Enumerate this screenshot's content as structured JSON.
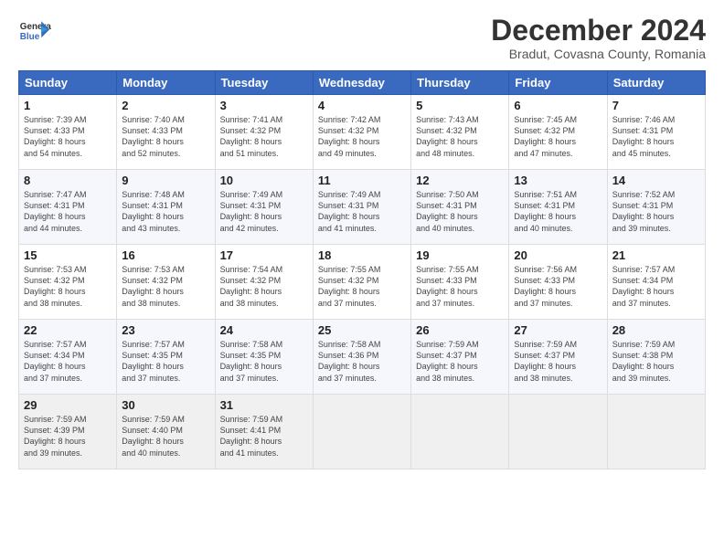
{
  "logo": {
    "line1": "General",
    "line2": "Blue"
  },
  "title": "December 2024",
  "subtitle": "Bradut, Covasna County, Romania",
  "weekdays": [
    "Sunday",
    "Monday",
    "Tuesday",
    "Wednesday",
    "Thursday",
    "Friday",
    "Saturday"
  ],
  "weeks": [
    [
      {
        "day": "1",
        "lines": [
          "Sunrise: 7:39 AM",
          "Sunset: 4:33 PM",
          "Daylight: 8 hours",
          "and 54 minutes."
        ]
      },
      {
        "day": "2",
        "lines": [
          "Sunrise: 7:40 AM",
          "Sunset: 4:33 PM",
          "Daylight: 8 hours",
          "and 52 minutes."
        ]
      },
      {
        "day": "3",
        "lines": [
          "Sunrise: 7:41 AM",
          "Sunset: 4:32 PM",
          "Daylight: 8 hours",
          "and 51 minutes."
        ]
      },
      {
        "day": "4",
        "lines": [
          "Sunrise: 7:42 AM",
          "Sunset: 4:32 PM",
          "Daylight: 8 hours",
          "and 49 minutes."
        ]
      },
      {
        "day": "5",
        "lines": [
          "Sunrise: 7:43 AM",
          "Sunset: 4:32 PM",
          "Daylight: 8 hours",
          "and 48 minutes."
        ]
      },
      {
        "day": "6",
        "lines": [
          "Sunrise: 7:45 AM",
          "Sunset: 4:32 PM",
          "Daylight: 8 hours",
          "and 47 minutes."
        ]
      },
      {
        "day": "7",
        "lines": [
          "Sunrise: 7:46 AM",
          "Sunset: 4:31 PM",
          "Daylight: 8 hours",
          "and 45 minutes."
        ]
      }
    ],
    [
      {
        "day": "8",
        "lines": [
          "Sunrise: 7:47 AM",
          "Sunset: 4:31 PM",
          "Daylight: 8 hours",
          "and 44 minutes."
        ]
      },
      {
        "day": "9",
        "lines": [
          "Sunrise: 7:48 AM",
          "Sunset: 4:31 PM",
          "Daylight: 8 hours",
          "and 43 minutes."
        ]
      },
      {
        "day": "10",
        "lines": [
          "Sunrise: 7:49 AM",
          "Sunset: 4:31 PM",
          "Daylight: 8 hours",
          "and 42 minutes."
        ]
      },
      {
        "day": "11",
        "lines": [
          "Sunrise: 7:49 AM",
          "Sunset: 4:31 PM",
          "Daylight: 8 hours",
          "and 41 minutes."
        ]
      },
      {
        "day": "12",
        "lines": [
          "Sunrise: 7:50 AM",
          "Sunset: 4:31 PM",
          "Daylight: 8 hours",
          "and 40 minutes."
        ]
      },
      {
        "day": "13",
        "lines": [
          "Sunrise: 7:51 AM",
          "Sunset: 4:31 PM",
          "Daylight: 8 hours",
          "and 40 minutes."
        ]
      },
      {
        "day": "14",
        "lines": [
          "Sunrise: 7:52 AM",
          "Sunset: 4:31 PM",
          "Daylight: 8 hours",
          "and 39 minutes."
        ]
      }
    ],
    [
      {
        "day": "15",
        "lines": [
          "Sunrise: 7:53 AM",
          "Sunset: 4:32 PM",
          "Daylight: 8 hours",
          "and 38 minutes."
        ]
      },
      {
        "day": "16",
        "lines": [
          "Sunrise: 7:53 AM",
          "Sunset: 4:32 PM",
          "Daylight: 8 hours",
          "and 38 minutes."
        ]
      },
      {
        "day": "17",
        "lines": [
          "Sunrise: 7:54 AM",
          "Sunset: 4:32 PM",
          "Daylight: 8 hours",
          "and 38 minutes."
        ]
      },
      {
        "day": "18",
        "lines": [
          "Sunrise: 7:55 AM",
          "Sunset: 4:32 PM",
          "Daylight: 8 hours",
          "and 37 minutes."
        ]
      },
      {
        "day": "19",
        "lines": [
          "Sunrise: 7:55 AM",
          "Sunset: 4:33 PM",
          "Daylight: 8 hours",
          "and 37 minutes."
        ]
      },
      {
        "day": "20",
        "lines": [
          "Sunrise: 7:56 AM",
          "Sunset: 4:33 PM",
          "Daylight: 8 hours",
          "and 37 minutes."
        ]
      },
      {
        "day": "21",
        "lines": [
          "Sunrise: 7:57 AM",
          "Sunset: 4:34 PM",
          "Daylight: 8 hours",
          "and 37 minutes."
        ]
      }
    ],
    [
      {
        "day": "22",
        "lines": [
          "Sunrise: 7:57 AM",
          "Sunset: 4:34 PM",
          "Daylight: 8 hours",
          "and 37 minutes."
        ]
      },
      {
        "day": "23",
        "lines": [
          "Sunrise: 7:57 AM",
          "Sunset: 4:35 PM",
          "Daylight: 8 hours",
          "and 37 minutes."
        ]
      },
      {
        "day": "24",
        "lines": [
          "Sunrise: 7:58 AM",
          "Sunset: 4:35 PM",
          "Daylight: 8 hours",
          "and 37 minutes."
        ]
      },
      {
        "day": "25",
        "lines": [
          "Sunrise: 7:58 AM",
          "Sunset: 4:36 PM",
          "Daylight: 8 hours",
          "and 37 minutes."
        ]
      },
      {
        "day": "26",
        "lines": [
          "Sunrise: 7:59 AM",
          "Sunset: 4:37 PM",
          "Daylight: 8 hours",
          "and 38 minutes."
        ]
      },
      {
        "day": "27",
        "lines": [
          "Sunrise: 7:59 AM",
          "Sunset: 4:37 PM",
          "Daylight: 8 hours",
          "and 38 minutes."
        ]
      },
      {
        "day": "28",
        "lines": [
          "Sunrise: 7:59 AM",
          "Sunset: 4:38 PM",
          "Daylight: 8 hours",
          "and 39 minutes."
        ]
      }
    ],
    [
      {
        "day": "29",
        "lines": [
          "Sunrise: 7:59 AM",
          "Sunset: 4:39 PM",
          "Daylight: 8 hours",
          "and 39 minutes."
        ]
      },
      {
        "day": "30",
        "lines": [
          "Sunrise: 7:59 AM",
          "Sunset: 4:40 PM",
          "Daylight: 8 hours",
          "and 40 minutes."
        ]
      },
      {
        "day": "31",
        "lines": [
          "Sunrise: 7:59 AM",
          "Sunset: 4:41 PM",
          "Daylight: 8 hours",
          "and 41 minutes."
        ]
      },
      null,
      null,
      null,
      null
    ]
  ]
}
